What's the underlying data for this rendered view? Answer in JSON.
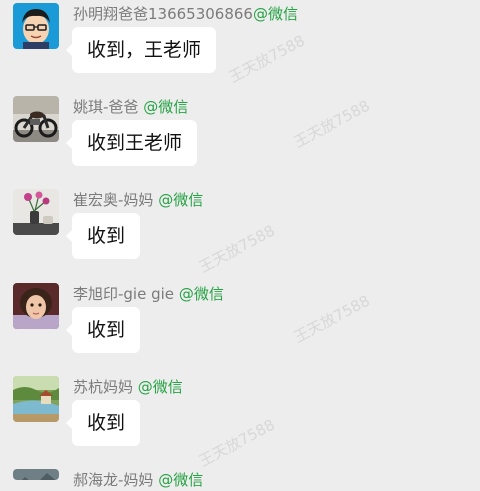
{
  "colors": {
    "background": "#ededed",
    "bubble": "#ffffff",
    "sender_name": "#7b7b7b",
    "wechat_tag": "#25a244",
    "message_text": "#111111"
  },
  "messages": [
    {
      "sender": "孙明翔爸爸13665306866",
      "source": "@微信",
      "text": "收到，王老师",
      "avatar_icon": "cartoon-boy-avatar-icon"
    },
    {
      "sender": "姚琪-爸爸",
      "source": "@微信",
      "text": "收到王老师",
      "avatar_icon": "motorcycle-avatar-icon"
    },
    {
      "sender": "崔宏奥-妈妈",
      "source": "@微信",
      "text": "收到",
      "avatar_icon": "flower-vase-avatar-icon"
    },
    {
      "sender": "李旭印-gie gie",
      "source": "@微信",
      "text": "收到",
      "avatar_icon": "child-photo-avatar-icon"
    },
    {
      "sender": "苏杭妈妈",
      "source": "@微信",
      "text": "收到",
      "avatar_icon": "garden-avatar-icon"
    },
    {
      "sender": "郝海龙-妈妈",
      "source": "@微信",
      "avatar_icon": "landscape-avatar-icon"
    }
  ],
  "watermark": "王天放7588"
}
